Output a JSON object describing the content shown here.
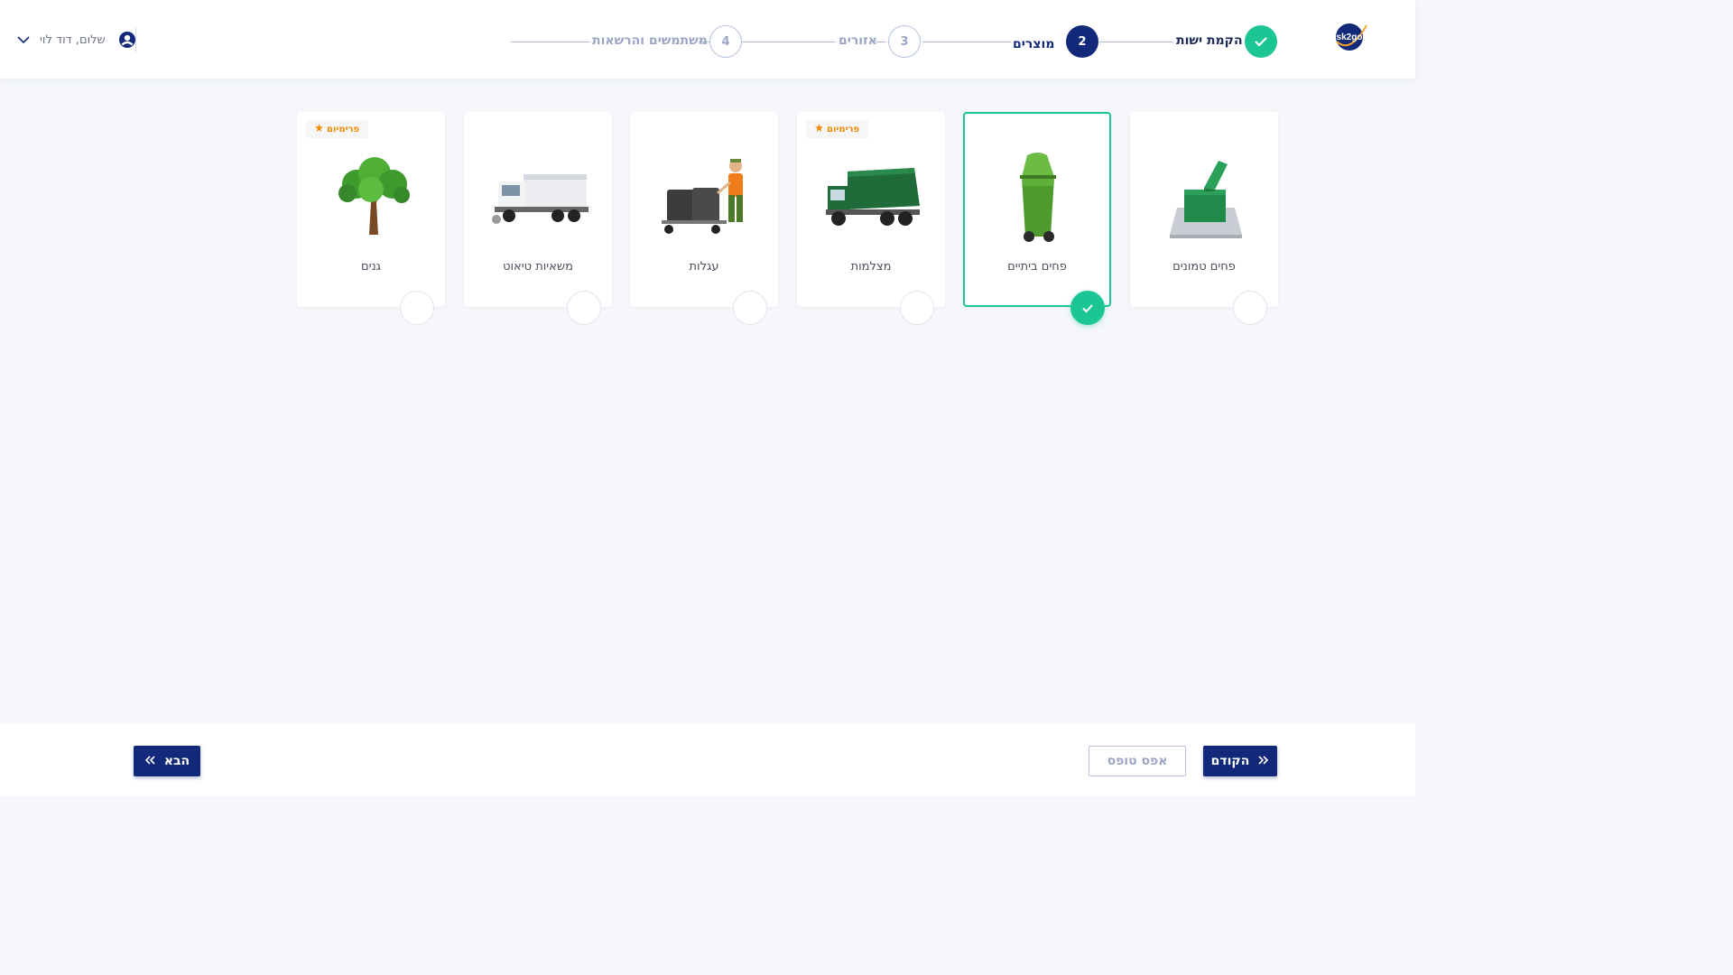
{
  "header": {
    "logo_text": "sk2go",
    "user_greeting": "שלום, דוד לוי"
  },
  "stepper": {
    "steps": [
      {
        "label": "הקמת ישות",
        "state": "done",
        "number": ""
      },
      {
        "label": "מוצרים",
        "state": "active",
        "number": "2"
      },
      {
        "label": "אזורים",
        "state": "pending",
        "number": "3"
      },
      {
        "label": "משתמשים והרשאות",
        "state": "pending",
        "number": "4"
      }
    ]
  },
  "products": {
    "premium_label": "פרימיום",
    "items": [
      {
        "label": "פחים טמונים",
        "selected": false,
        "premium": false,
        "icon": "underground-bin-icon"
      },
      {
        "label": "פחים ביתיים",
        "selected": true,
        "premium": false,
        "icon": "household-bin-icon"
      },
      {
        "label": "מצלמות",
        "selected": false,
        "premium": true,
        "icon": "garbage-truck-icon"
      },
      {
        "label": "עגלות",
        "selected": false,
        "premium": false,
        "icon": "cart-worker-icon"
      },
      {
        "label": "משאיות טיאוט",
        "selected": false,
        "premium": false,
        "icon": "sweeper-truck-icon"
      },
      {
        "label": "גנים",
        "selected": false,
        "premium": true,
        "icon": "tree-icon"
      }
    ]
  },
  "footer": {
    "previous_label": "הקודם",
    "reset_label": "אפס טופס",
    "next_label": "הבא"
  },
  "colors": {
    "primary": "#12297a",
    "success": "#1cc694",
    "premium": "#f08a00",
    "background": "#f5f7fb"
  }
}
